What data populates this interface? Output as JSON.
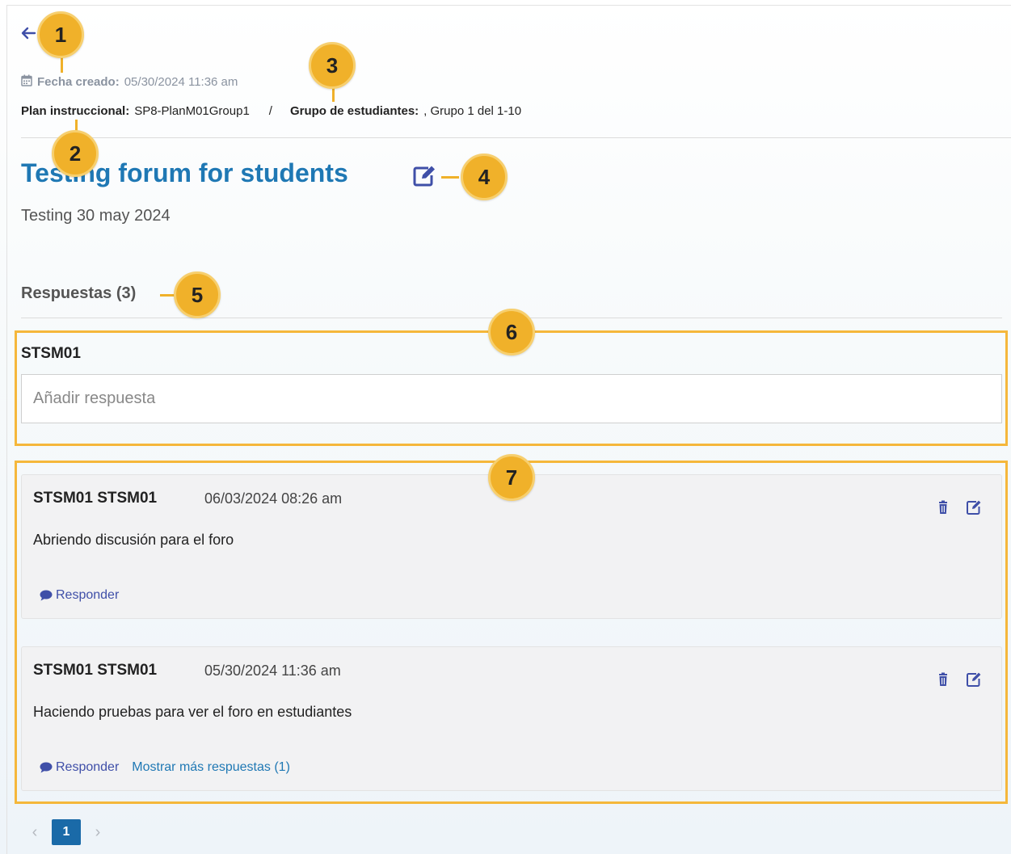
{
  "header": {
    "fecha_label": "Fecha creado:",
    "fecha_value": "05/30/2024 11:36 am",
    "plan_label": "Plan instruccional:",
    "plan_value": "SP8-PlanM01Group1",
    "separator": "/",
    "grupo_label": "Grupo de estudiantes:",
    "grupo_value": ", Grupo 1 del 1-10"
  },
  "forum": {
    "title": "Testing forum for students",
    "description": "Testing 30 may 2024"
  },
  "responses": {
    "heading": "Respuestas (3)",
    "current_user": "STSM01",
    "input_placeholder": "Añadir respuesta",
    "input_value": "",
    "items": [
      {
        "author": "STSM01 STSM01",
        "date": "06/03/2024 08:26 am",
        "text": "Abriendo discusión para el foro",
        "reply_label": "Responder",
        "more_label": ""
      },
      {
        "author": "STSM01 STSM01",
        "date": "05/30/2024 11:36 am",
        "text": "Haciendo pruebas para ver el foro en estudiantes",
        "reply_label": "Responder",
        "more_label": "Mostrar más respuestas (1)"
      }
    ]
  },
  "pagination": {
    "current_page": "1",
    "prev_glyph": "‹",
    "next_glyph": "›"
  },
  "callouts": [
    "1",
    "2",
    "3",
    "4",
    "5",
    "6",
    "7"
  ],
  "icons": {
    "back": "arrow-left-icon",
    "calendar": "calendar-icon",
    "edit": "edit-icon",
    "delete": "trash-icon",
    "comment": "comment-icon"
  },
  "colors": {
    "title": "#1f78b4",
    "accent": "#3f4fa8",
    "callout": "#f0b12a",
    "pager_active": "#1a6aa8"
  }
}
